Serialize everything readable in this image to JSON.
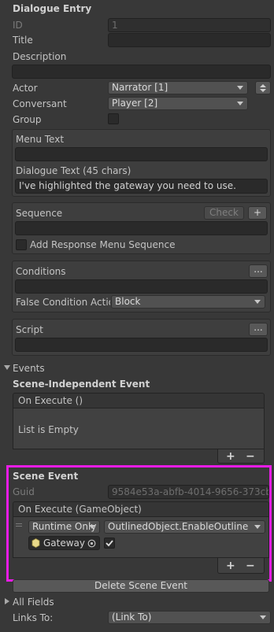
{
  "header": {
    "title": "Dialogue Entry"
  },
  "fields": {
    "id": {
      "label": "ID",
      "value": "1"
    },
    "title": {
      "label": "Title",
      "value": ""
    },
    "description": {
      "label": "Description",
      "value": ""
    },
    "actor": {
      "label": "Actor",
      "value": "Narrator [1]"
    },
    "conversant": {
      "label": "Conversant",
      "value": "Player [2]"
    },
    "group": {
      "label": "Group"
    }
  },
  "text_section": {
    "menu_text_label": "Menu Text",
    "menu_text_value": "",
    "dialogue_text_label": "Dialogue Text (45 chars)",
    "dialogue_text_value": "I've highlighted the gateway you need to use."
  },
  "sequence_section": {
    "label": "Sequence",
    "check_button": "Check",
    "plus_button": "+",
    "value": "",
    "add_response_label": "Add Response Menu Sequence"
  },
  "conditions_section": {
    "label": "Conditions",
    "menu_button": "...",
    "value": "",
    "false_condition_label": "False Condition Actio",
    "false_condition_value": "Block"
  },
  "script_section": {
    "label": "Script",
    "menu_button": "...",
    "value": ""
  },
  "events": {
    "foldout_label": "Events",
    "scene_independent": {
      "title": "Scene-Independent Event",
      "list_header": "On Execute ()",
      "empty_text": "List is Empty",
      "plus": "+",
      "minus": "−"
    },
    "scene_event": {
      "title": "Scene Event",
      "guid_label": "Guid",
      "guid_value": "9584e53a-abfb-4014-9656-373cb",
      "list_header": "On Execute (GameObject)",
      "runtime_value": "Runtime Only",
      "function_value": "OutlinedObject.EnableOutline",
      "object_value": "Gateway",
      "plus": "+",
      "minus": "−",
      "highlight_color": "#e81ce6"
    },
    "delete_button": "Delete Scene Event"
  },
  "footer": {
    "all_fields_label": "All Fields",
    "links_to_label": "Links To:",
    "links_to_value": "(Link To)"
  }
}
